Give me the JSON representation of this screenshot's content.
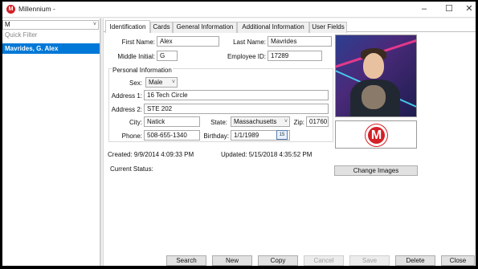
{
  "window": {
    "title": "Millennium -",
    "icon_letter": "M",
    "min_glyph": "–",
    "max_glyph": "☐",
    "close_glyph": "✕"
  },
  "left": {
    "filter_value": "M",
    "quick_filter_placeholder": "Quick Filter",
    "selected_item": "Mavrides, G. Alex"
  },
  "tabs": [
    "Identification",
    "Cards",
    "General Information",
    "Additional Information",
    "User Fields"
  ],
  "identification": {
    "first_name_label": "First Name:",
    "first_name": "Alex",
    "last_name_label": "Last Name:",
    "last_name": "Mavrides",
    "middle_initial_label": "Middle Initial:",
    "middle_initial": "G",
    "employee_id_label": "Employee ID:",
    "employee_id": "17289"
  },
  "personal": {
    "group_title": "Personal Information",
    "sex_label": "Sex:",
    "sex": "Male",
    "address1_label": "Address 1:",
    "address1": "16 Tech Circle",
    "address2_label": "Address 2:",
    "address2": "STE 202",
    "city_label": "City:",
    "city": "Natick",
    "state_label": "State:",
    "state": "Massachusetts",
    "zip_label": "Zip:",
    "zip": "01760",
    "phone_label": "Phone:",
    "phone": "508-655-1340",
    "birthday_label": "Birthday:",
    "birthday": "1/1/1989",
    "calendar_glyph": "15"
  },
  "meta": {
    "created": "Created: 9/9/2014 4:09:33 PM",
    "updated": "Updated: 5/15/2018 4:35:52 PM",
    "current_status_label": "Current Status:"
  },
  "images": {
    "logo_letter": "M",
    "change_images_label": "Change Images"
  },
  "actions": {
    "search": "Search",
    "new": "New",
    "copy": "Copy",
    "cancel": "Cancel",
    "save": "Save",
    "delete": "Delete",
    "close": "Close"
  },
  "colors": {
    "selection": "#0078d7",
    "brand_red": "#d42027"
  }
}
